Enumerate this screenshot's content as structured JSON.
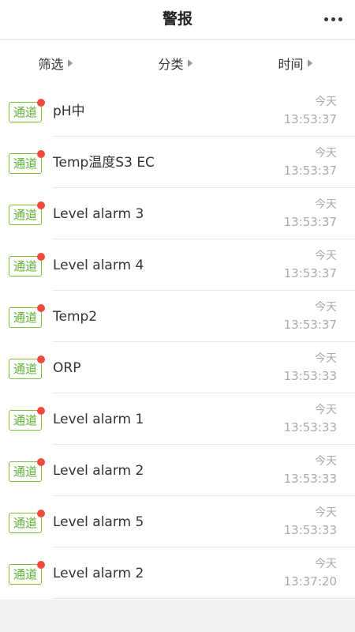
{
  "header": {
    "title": "警报",
    "more_icon": "more-horizontal-icon"
  },
  "filters": [
    {
      "label": "筛选"
    },
    {
      "label": "分类"
    },
    {
      "label": "时间"
    }
  ],
  "alarms": [
    {
      "badge": "通道",
      "title": "pH中",
      "day": "今天",
      "time": "13:53:37"
    },
    {
      "badge": "通道",
      "title": "Temp温度S3 EC",
      "day": "今天",
      "time": "13:53:37"
    },
    {
      "badge": "通道",
      "title": "Level alarm 3",
      "day": "今天",
      "time": "13:53:37"
    },
    {
      "badge": "通道",
      "title": "Level alarm 4",
      "day": "今天",
      "time": "13:53:37"
    },
    {
      "badge": "通道",
      "title": "Temp2",
      "day": "今天",
      "time": "13:53:37"
    },
    {
      "badge": "通道",
      "title": "ORP",
      "day": "今天",
      "time": "13:53:33"
    },
    {
      "badge": "通道",
      "title": "Level alarm 1",
      "day": "今天",
      "time": "13:53:33"
    },
    {
      "badge": "通道",
      "title": "Level alarm 2",
      "day": "今天",
      "time": "13:53:33"
    },
    {
      "badge": "通道",
      "title": "Level alarm 5",
      "day": "今天",
      "time": "13:53:33"
    },
    {
      "badge": "通道",
      "title": "Level alarm 2",
      "day": "今天",
      "time": "13:37:20"
    }
  ],
  "colors": {
    "badge_border": "#7ac143",
    "badge_text": "#5fb336",
    "unread_dot": "#f04a3e"
  }
}
